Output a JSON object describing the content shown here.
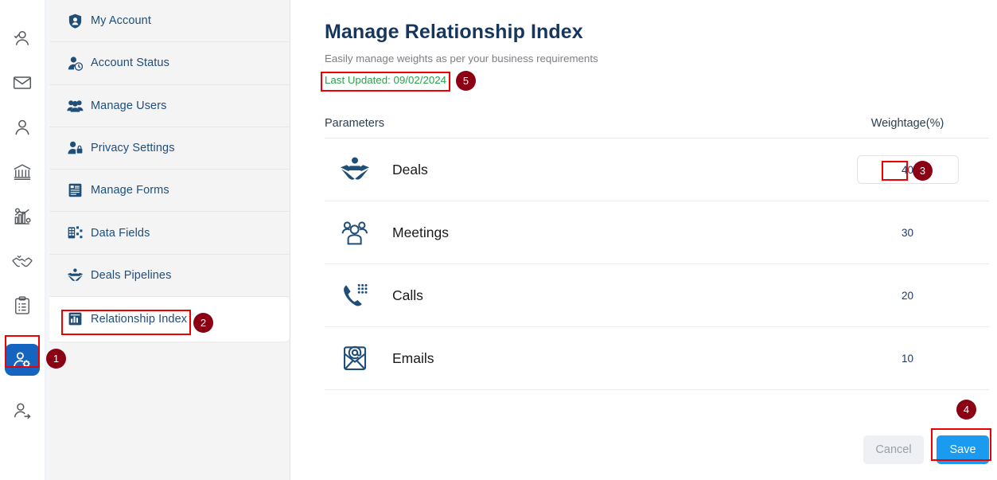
{
  "icon_rail": {
    "items": [
      {
        "name": "user-check-icon",
        "active": false
      },
      {
        "name": "envelope-icon",
        "active": false
      },
      {
        "name": "user-icon",
        "active": false
      },
      {
        "name": "bank-icon",
        "active": false
      },
      {
        "name": "analytics-gear-icon",
        "active": false
      },
      {
        "name": "handshake-check-icon",
        "active": false
      },
      {
        "name": "clipboard-list-icon",
        "active": false
      },
      {
        "name": "user-settings-icon",
        "active": true
      },
      {
        "name": "user-arrow-icon",
        "active": false
      }
    ]
  },
  "sidebar": {
    "items": [
      {
        "label": "My Account",
        "icon": "shield-user-icon",
        "active": false
      },
      {
        "label": "Account Status",
        "icon": "user-clock-icon",
        "active": false
      },
      {
        "label": "Manage Users",
        "icon": "users-icon",
        "active": false
      },
      {
        "label": "Privacy Settings",
        "icon": "user-lock-icon",
        "active": false
      },
      {
        "label": "Manage Forms",
        "icon": "form-icon",
        "active": false
      },
      {
        "label": "Data Fields",
        "icon": "data-fields-icon",
        "active": false
      },
      {
        "label": "Deals Pipelines",
        "icon": "handshake-icon",
        "active": false
      },
      {
        "label": "Relationship Index",
        "icon": "bar-chart-icon",
        "active": true
      }
    ]
  },
  "main": {
    "title": "Manage Relationship Index",
    "subtitle": "Easily manage weights as per your business requirements",
    "last_updated": "Last Updated: 09/02/2024",
    "table": {
      "headers": {
        "parameters": "Parameters",
        "weightage": "Weightage(%)"
      },
      "rows": [
        {
          "label": "Deals",
          "icon": "handshake-deal-icon",
          "weight": "40",
          "editable": true
        },
        {
          "label": "Meetings",
          "icon": "meeting-people-icon",
          "weight": "30",
          "editable": false
        },
        {
          "label": "Calls",
          "icon": "phone-keypad-icon",
          "weight": "20",
          "editable": false
        },
        {
          "label": "Emails",
          "icon": "email-at-icon",
          "weight": "10",
          "editable": false
        }
      ]
    },
    "actions": {
      "cancel_label": "Cancel",
      "save_label": "Save"
    }
  },
  "annotations": [
    {
      "badge": "1"
    },
    {
      "badge": "2"
    },
    {
      "badge": "3"
    },
    {
      "badge": "4"
    },
    {
      "badge": "5"
    }
  ],
  "colors": {
    "accent_blue": "#1565c0",
    "save_blue": "#1b9bf0",
    "title_navy": "#17365d",
    "sidebar_label": "#1f4e79",
    "green_status": "#2aa24a",
    "annotation_red": "#ee0000",
    "annotation_badge": "#8b0012"
  }
}
